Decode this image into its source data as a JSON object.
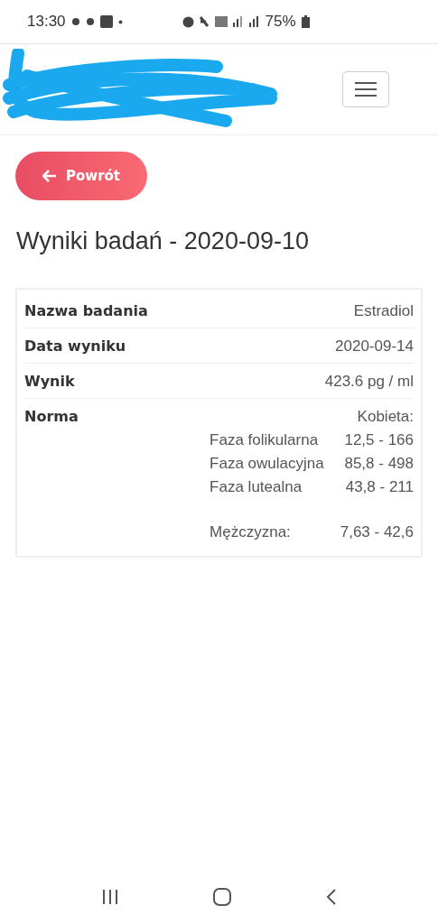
{
  "status_bar": {
    "time": "13:30",
    "battery": "75%"
  },
  "back_button": {
    "label": "Powrót"
  },
  "title": "Wyniki badań - 2020-09-10",
  "details": [
    {
      "label": "Nazwa badania",
      "value": "Estradiol"
    },
    {
      "label": "Data wyniku",
      "value": "2020-09-14"
    },
    {
      "label": "Wynik",
      "value": "423.6 pg / ml"
    }
  ],
  "norm": {
    "label": "Norma",
    "female_label": "Kobieta:",
    "female_ranges": [
      {
        "phase": "Faza folikularna",
        "range": "12,5 - 166"
      },
      {
        "phase": "Faza owulacyjna",
        "range": "85,8 - 498"
      },
      {
        "phase": "Faza lutealna",
        "range": "43,8 - 211"
      }
    ],
    "male_label": "Mężczyzna:",
    "male_range": "7,63 - 42,6"
  }
}
